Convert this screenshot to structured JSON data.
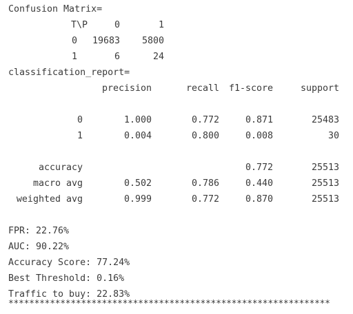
{
  "confusion_matrix": {
    "title": "Confusion Matrix=",
    "corner_label": "T\\P",
    "col_headers": [
      "0",
      "1"
    ],
    "rows": [
      {
        "label": "0",
        "values": [
          "19683",
          "5800"
        ]
      },
      {
        "label": "1",
        "values": [
          "6",
          "24"
        ]
      }
    ]
  },
  "classification_report": {
    "title": "classification_report=",
    "headers": [
      "precision",
      "recall",
      "f1-score",
      "support"
    ],
    "class_rows": [
      {
        "label": "0",
        "precision": "1.000",
        "recall": "0.772",
        "f1": "0.871",
        "support": "25483"
      },
      {
        "label": "1",
        "precision": "0.004",
        "recall": "0.800",
        "f1": "0.008",
        "support": "30"
      }
    ],
    "accuracy": {
      "label": "accuracy",
      "f1": "0.772",
      "support": "25513"
    },
    "macro_avg": {
      "label": "macro avg",
      "precision": "0.502",
      "recall": "0.786",
      "f1": "0.440",
      "support": "25513"
    },
    "weighted_avg": {
      "label": "weighted avg",
      "precision": "0.999",
      "recall": "0.772",
      "f1": "0.870",
      "support": "25513"
    }
  },
  "metrics": {
    "fpr": "FPR: 22.76%",
    "auc": "AUC: 90.22%",
    "accuracy_score": "Accuracy Score: 77.24%",
    "best_threshold": "Best Threshold: 0.16%",
    "traffic_to_buy": "Traffic to buy: 22.83%"
  },
  "separator": "**************************************************************"
}
